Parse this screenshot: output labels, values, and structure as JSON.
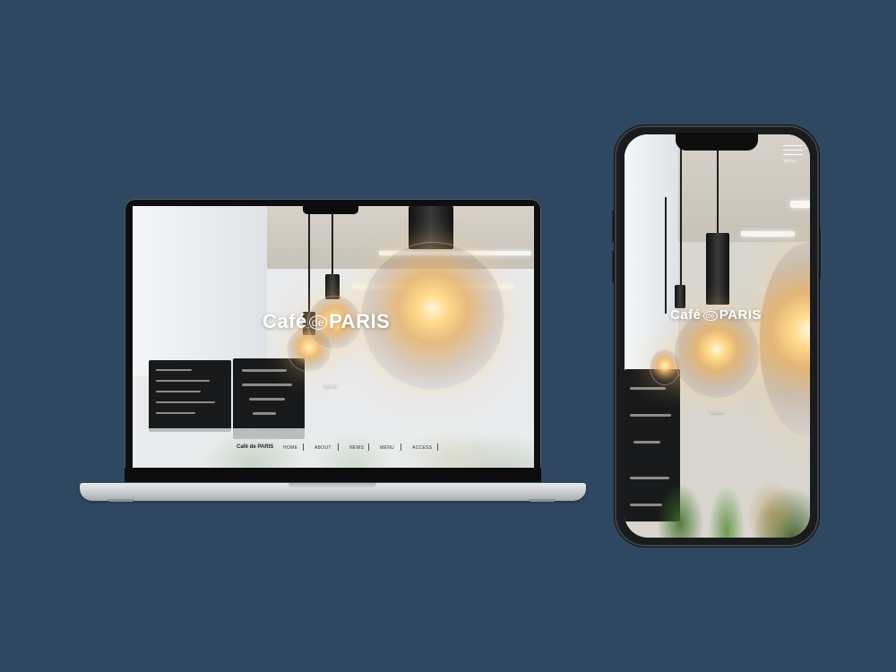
{
  "laptop": {
    "brand": "Café de PARIS",
    "brand_main": "Café",
    "brand_de": "de",
    "brand_tail": "PARIS",
    "scroll_label": "Scroll",
    "nav": {
      "logo": "Café de PARIS",
      "items": [
        "HOME",
        "ABOUT",
        "NEWS",
        "MENU",
        "ACCESS"
      ]
    }
  },
  "phone": {
    "brand_main": "Café",
    "brand_de": "de",
    "brand_tail": "PARIS",
    "scroll_label": "Scroll",
    "menu_label": "MENU"
  },
  "colors": {
    "background": "#2f4760",
    "nav_bar": "#e8ecec",
    "logo_text": "#ffffff"
  }
}
